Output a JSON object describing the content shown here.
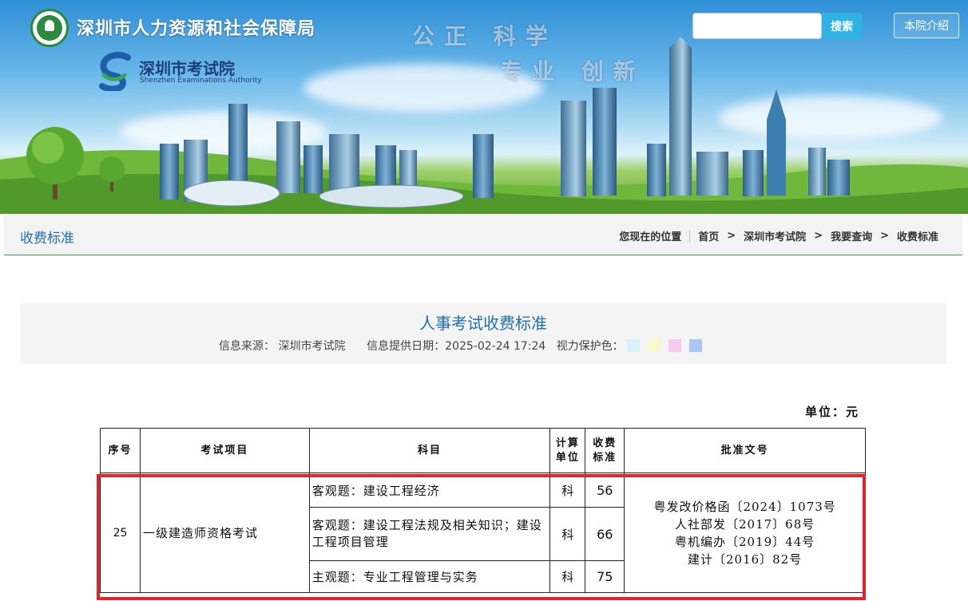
{
  "header": {
    "bureau_name": "深圳市人力资源和社会保障局",
    "exam_name_cn": "深圳市考试院",
    "exam_name_en": "Shenzhen Examinations Authority",
    "slogan_line1": "公正 科学",
    "slogan_line2": "专业 创新",
    "search_button": "搜索",
    "search_placeholder": "",
    "intro_button": "本院介绍"
  },
  "nav": {
    "page_title": "收费标准",
    "breadcrumb": {
      "location_label": "您现在的位置",
      "items": [
        "首页",
        "深圳市考试院",
        "我要查询",
        "收费标准"
      ]
    }
  },
  "article": {
    "title": "人事考试收费标准",
    "source": "信息来源： 深圳市考试院",
    "date": "信息提供日期：2025-02-24 17:24",
    "eye_care_label": "视力保护色：",
    "eye_care_colors": [
      "#d6f5f8",
      "#f8f8c8",
      "#f6c8f2",
      "#a8c8f4"
    ]
  },
  "fee_table": {
    "unit": "单位：元",
    "headers": [
      "序号",
      "考试项目",
      "科目",
      "计算单位",
      "收费标准",
      "批准文号"
    ],
    "row": {
      "no": "25",
      "project": "一级建造师资格考试",
      "subjects": [
        {
          "name": "客观题：建设工程经济",
          "unit": "科",
          "fee": "56"
        },
        {
          "name": "客观题：建设工程法规及相关知识；建设工程项目管理",
          "unit": "科",
          "fee": "66"
        },
        {
          "name": "主观题：专业工程管理与实务",
          "unit": "科",
          "fee": "75"
        }
      ],
      "approvals": [
        "粤发改价格函〔2024〕1073号",
        "人社部发〔2017〕68号",
        "粤机编办〔2019〕44号",
        "建计〔2016〕82号"
      ]
    }
  },
  "colors": {
    "accent_blue": "#1f6fb4",
    "nav_green": "#3aa14a",
    "highlight_red": "#e3232c",
    "search_blue": "#2fb2e6"
  }
}
